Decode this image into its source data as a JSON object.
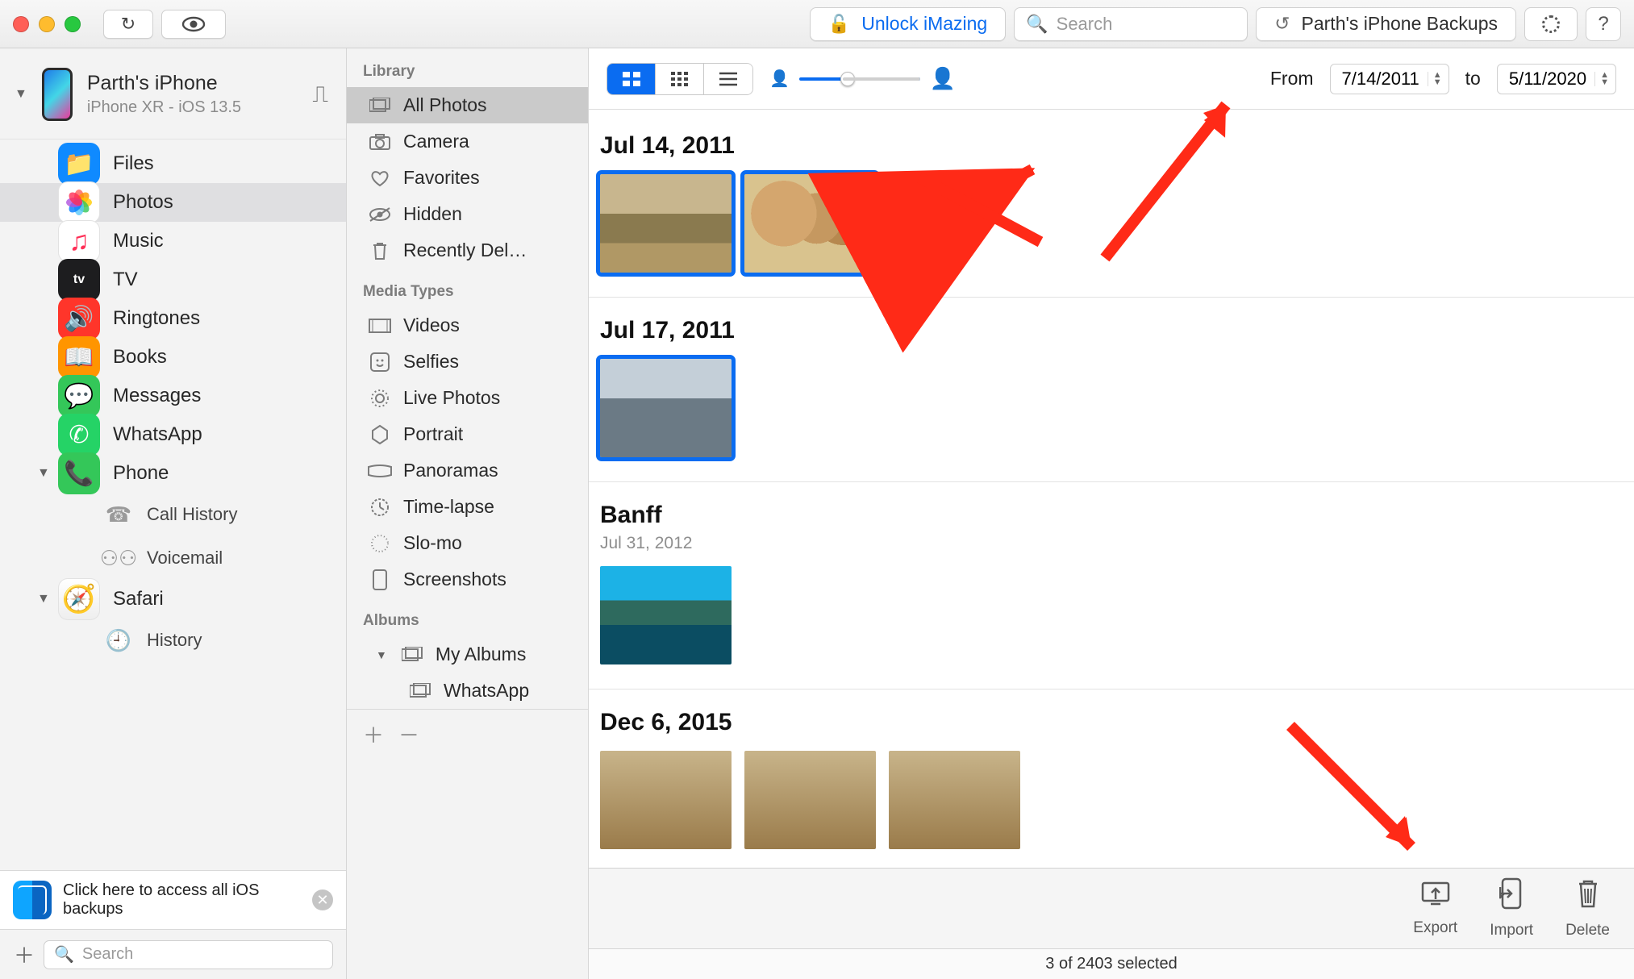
{
  "toolbar": {
    "unlock_label": "Unlock iMazing",
    "search_placeholder": "Search",
    "backups_label": "Parth's iPhone Backups"
  },
  "device": {
    "name": "Parth's iPhone",
    "subtitle": "iPhone XR - iOS 13.5"
  },
  "apps": [
    {
      "id": "files",
      "label": "Files"
    },
    {
      "id": "photos",
      "label": "Photos",
      "selected": true
    },
    {
      "id": "music",
      "label": "Music"
    },
    {
      "id": "tv",
      "label": "TV"
    },
    {
      "id": "ringtones",
      "label": "Ringtones"
    },
    {
      "id": "books",
      "label": "Books"
    },
    {
      "id": "messages",
      "label": "Messages"
    },
    {
      "id": "whatsapp",
      "label": "WhatsApp"
    },
    {
      "id": "phone",
      "label": "Phone",
      "expandable": true,
      "children": [
        {
          "id": "call_history",
          "label": "Call History"
        },
        {
          "id": "voicemail",
          "label": "Voicemail"
        }
      ]
    },
    {
      "id": "safari",
      "label": "Safari",
      "expandable": true,
      "children": [
        {
          "id": "history",
          "label": "History"
        }
      ]
    }
  ],
  "banner": {
    "text": "Click here to access all iOS backups"
  },
  "sidebar_search_placeholder": "Search",
  "library": {
    "sections": [
      {
        "title": "Library",
        "items": [
          {
            "id": "all_photos",
            "label": "All Photos",
            "icon": "photos",
            "selected": true
          },
          {
            "id": "camera",
            "label": "Camera",
            "icon": "camera"
          },
          {
            "id": "favorites",
            "label": "Favorites",
            "icon": "heart"
          },
          {
            "id": "hidden",
            "label": "Hidden",
            "icon": "eye-off"
          },
          {
            "id": "recently_deleted",
            "label": "Recently Del…",
            "icon": "trash"
          }
        ]
      },
      {
        "title": "Media Types",
        "items": [
          {
            "id": "videos",
            "label": "Videos",
            "icon": "video"
          },
          {
            "id": "selfies",
            "label": "Selfies",
            "icon": "selfie"
          },
          {
            "id": "live_photos",
            "label": "Live Photos",
            "icon": "live"
          },
          {
            "id": "portrait",
            "label": "Portrait",
            "icon": "portrait"
          },
          {
            "id": "panoramas",
            "label": "Panoramas",
            "icon": "pano"
          },
          {
            "id": "timelapse",
            "label": "Time-lapse",
            "icon": "timelapse"
          },
          {
            "id": "slomo",
            "label": "Slo-mo",
            "icon": "slomo"
          },
          {
            "id": "screenshots",
            "label": "Screenshots",
            "icon": "screenshot"
          }
        ]
      },
      {
        "title": "Albums",
        "items": [
          {
            "id": "my_albums",
            "label": "My Albums",
            "icon": "album",
            "expandable": true,
            "children": [
              {
                "id": "whatsapp_album",
                "label": "WhatsApp",
                "icon": "album"
              }
            ]
          }
        ]
      }
    ]
  },
  "date_filter": {
    "from_label": "From",
    "from_value": "7/14/2011",
    "to_label": "to",
    "to_value": "5/11/2020"
  },
  "groups": [
    {
      "title": "Jul 14, 2011",
      "thumbs": [
        {
          "sel": true,
          "cls": "t-outdoor1"
        },
        {
          "sel": true,
          "cls": "t-group"
        }
      ]
    },
    {
      "title": "Jul 17, 2011",
      "thumbs": [
        {
          "sel": true,
          "cls": "t-family"
        }
      ]
    },
    {
      "title": "Banff",
      "subtitle": "Jul 31, 2012",
      "thumbs": [
        {
          "sel": false,
          "cls": "t-mtn"
        }
      ]
    },
    {
      "title": "Dec 6, 2015",
      "thumbs": [
        {
          "sel": false,
          "cls": "t-dim"
        },
        {
          "sel": false,
          "cls": "t-dim"
        },
        {
          "sel": false,
          "cls": "t-dim"
        }
      ]
    }
  ],
  "footer": {
    "export": "Export",
    "import": "Import",
    "delete": "Delete"
  },
  "status": "3 of 2403 selected"
}
